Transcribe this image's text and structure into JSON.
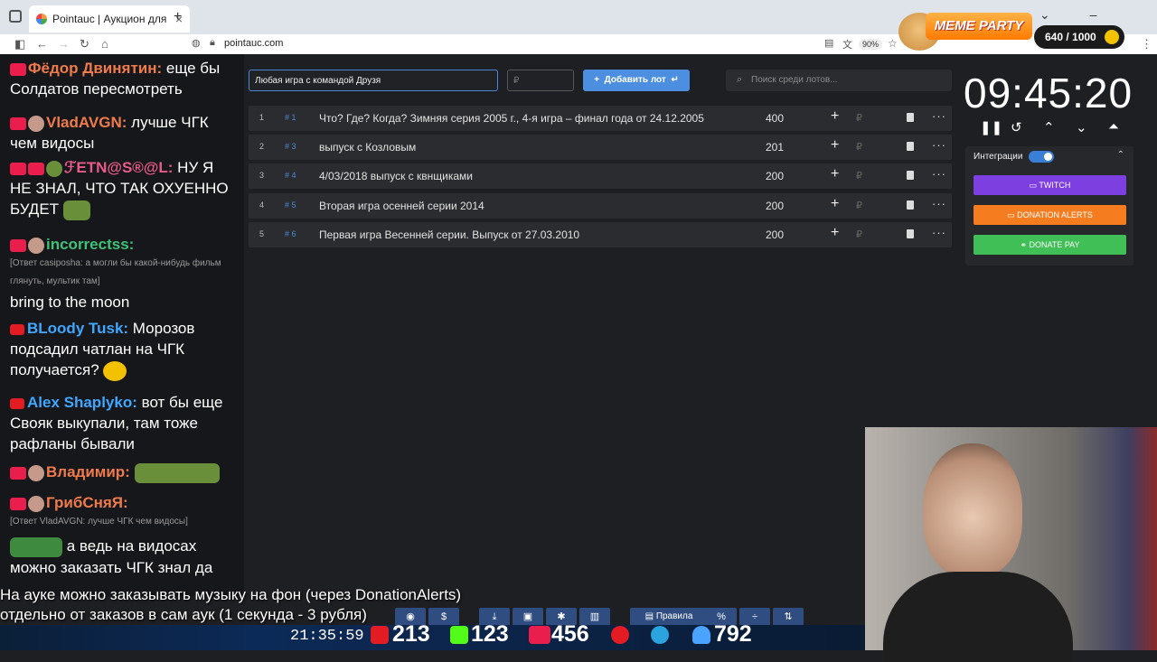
{
  "browser": {
    "tab_title": "Pointauc | Аукцион для стриме",
    "new_tab": "+",
    "url": "pointauc.com",
    "zoom": "90%"
  },
  "meme": {
    "title": "MEME PARTY",
    "coins": "640 / 1000"
  },
  "chat": [
    {
      "nick": "Фёдор Двинятин:",
      "text": " еще бы Солдатов пересмотреть",
      "nick_color": "#f07b4a"
    },
    {
      "nick": "VladAVGN:",
      "text": " лучше ЧГК чем видосы",
      "nick_color": "#f07b4a"
    },
    {
      "nick": "ℱETN@S®@L:",
      "text": " НУ Я НЕ ЗНАЛ, ЧТО ТАК ОХУЕННО БУДЕТ",
      "nick_color": "#e85a8a"
    },
    {
      "nick": "incorrectss:",
      "text": "",
      "nick_color": "#3ec27a"
    },
    {
      "reply": "[Ответ casiposha: а могли бы какой-нибудь фильм глянуть, мультик там]"
    },
    {
      "text": "bring to the moon"
    },
    {
      "nick": "BLoody Tusk:",
      "text": " Морозов подсадил чатлан на ЧГК получается?",
      "nick_color": "#3fa7ff"
    },
    {
      "nick": "Alex Shaplyko:",
      "text": " вот бы еще Свояк выкупали, там тоже рафланы бывали",
      "nick_color": "#3fa7ff"
    },
    {
      "nick": "Владимир:",
      "text": "",
      "nick_color": "#f07b4a"
    },
    {
      "nick": "ГрибСняЯ:",
      "text": "",
      "nick_color": "#f07b4a"
    },
    {
      "reply": "[Ответ VladAVGN: лучше ЧГК чем видосы]"
    },
    {
      "text": "а ведь на видосах можно заказать ЧГК знал да"
    }
  ],
  "form": {
    "lot_value": "Любая игра с командой Друзя",
    "amount_placeholder": "₽",
    "add_label": "Добавить лот",
    "search_placeholder": "Поиск среди лотов..."
  },
  "lots": [
    {
      "n": "1",
      "id": "# 1",
      "name": "Что? Где? Когда? Зимняя серия 2005 г., 4-я игра – финал года от 24.12.2005",
      "amount": "400"
    },
    {
      "n": "2",
      "id": "# 3",
      "name": "выпуск с Козловым",
      "amount": "201"
    },
    {
      "n": "3",
      "id": "# 4",
      "name": "4/03/2018 выпуск с квнщиками",
      "amount": "200"
    },
    {
      "n": "4",
      "id": "# 5",
      "name": "Вторая игра осенней серии 2014",
      "amount": "200"
    },
    {
      "n": "5",
      "id": "# 6",
      "name": "Первая игра Весенней серии. Выпуск от 27.03.2010",
      "amount": "200"
    }
  ],
  "row_icons": {
    "plus": "+",
    "rub": "₽",
    "more": "···"
  },
  "timer": "09:45:20",
  "integrations": {
    "label": "Интеграции",
    "twitch": "TWITCH",
    "donation_alerts": "DONATION ALERTS",
    "donate_pay": "DONATE PAY"
  },
  "overlay": {
    "line1": "На ауке можно заказывать музыку на фон (через DonationAlerts)",
    "line2": "отдельно от заказов в сам аук (1 секунда - 3 рубля)"
  },
  "toolbar": {
    "rules": "Правила"
  },
  "stats": {
    "clock": "21:35:59",
    "youtube": "213",
    "kick": "123",
    "live": "456",
    "viewers": "792"
  },
  "colors": {
    "accent": "#4c8fe0",
    "twitch": "#7d3fe0",
    "donation_alerts": "#f57c1f",
    "donate_pay": "#3fbf55"
  }
}
